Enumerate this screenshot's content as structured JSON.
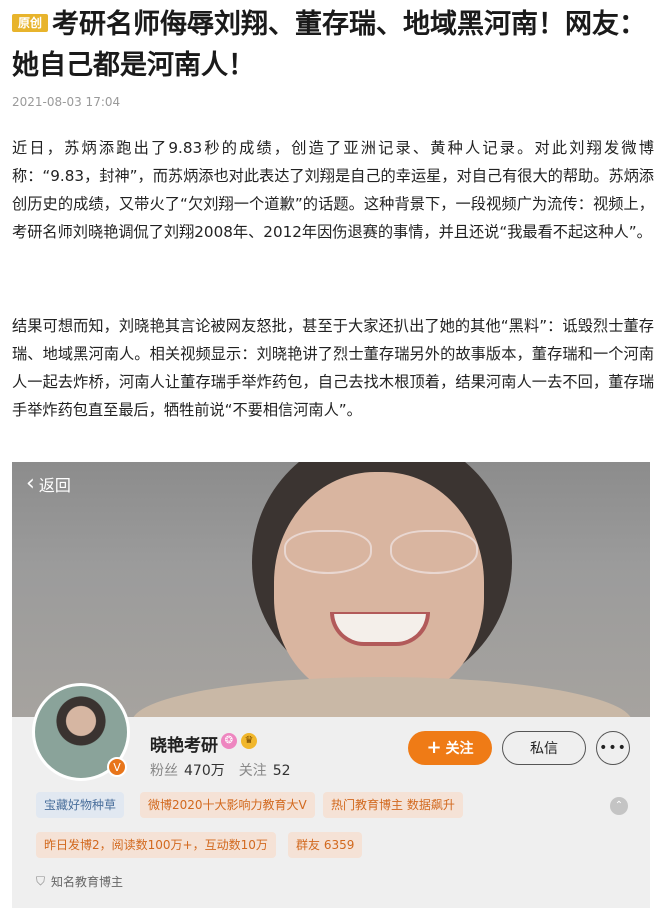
{
  "article": {
    "badge": "原创",
    "title": "考研名师侮辱刘翔、董存瑞、地域黑河南！网友：她自己都是河南人！",
    "date": "2021-08-03 17:04",
    "paragraph1": "近日，苏炳添跑出了9.83秒的成绩，创造了亚洲记录、黄种人记录。对此刘翔发微博称：“9.83，封神”，而苏炳添也对此表达了刘翔是自己的幸运星，对自己有很大的帮助。苏炳添创历史的成绩，又带火了“欠刘翔一个道歉”的话题。这种背景下，一段视频广为流传：视频上，考研名师刘晓艳调侃了刘翔2008年、2012年因伤退赛的事情，并且还说“我最看不起这种人”。",
    "paragraph2": "结果可想而知，刘晓艳其言论被网友怒批，甚至于大家还扒出了她的其他“黑料”：诋毁烈士董存瑞、地域黑河南人。相关视频显示：刘晓艳讲了烈士董存瑞另外的故事版本，董存瑞和一个河南人一起去炸桥，河南人让董存瑞手举炸药包，自己去找木根顶着，结果河南人一去不回，董存瑞手举炸药包直至最后，牺牲前说“不要相信河南人”。"
  },
  "screenshot": {
    "back_label": "返回",
    "profile": {
      "name": "晓艳考研",
      "fans_label": "粉丝",
      "fans_value": "470万",
      "following_label": "关注",
      "following_value": "52",
      "follow_button": "关注",
      "message_button": "私信",
      "more_glyph": "•••",
      "verified_glyph": "V",
      "known_label": "知名教育博主"
    },
    "tags_row1": [
      "宝藏好物种草",
      "微博2020十大影响力教育大V",
      "热门教育博主 数据飙升"
    ],
    "tags_row2": [
      "昨日发博2，阅读数100万+，互动数10万",
      "群友 6359"
    ]
  },
  "colors": {
    "accent_orange": "#ef7b16",
    "badge_gold": "#e8b42c",
    "tag_blue_text": "#4a6f9c",
    "tag_orange_text": "#d2691e"
  },
  "icons": [
    "chevron-left-icon",
    "plus-icon",
    "more-icon",
    "verified-icon",
    "super-topic-icon",
    "crown-icon",
    "collapse-icon",
    "shield-icon"
  ]
}
